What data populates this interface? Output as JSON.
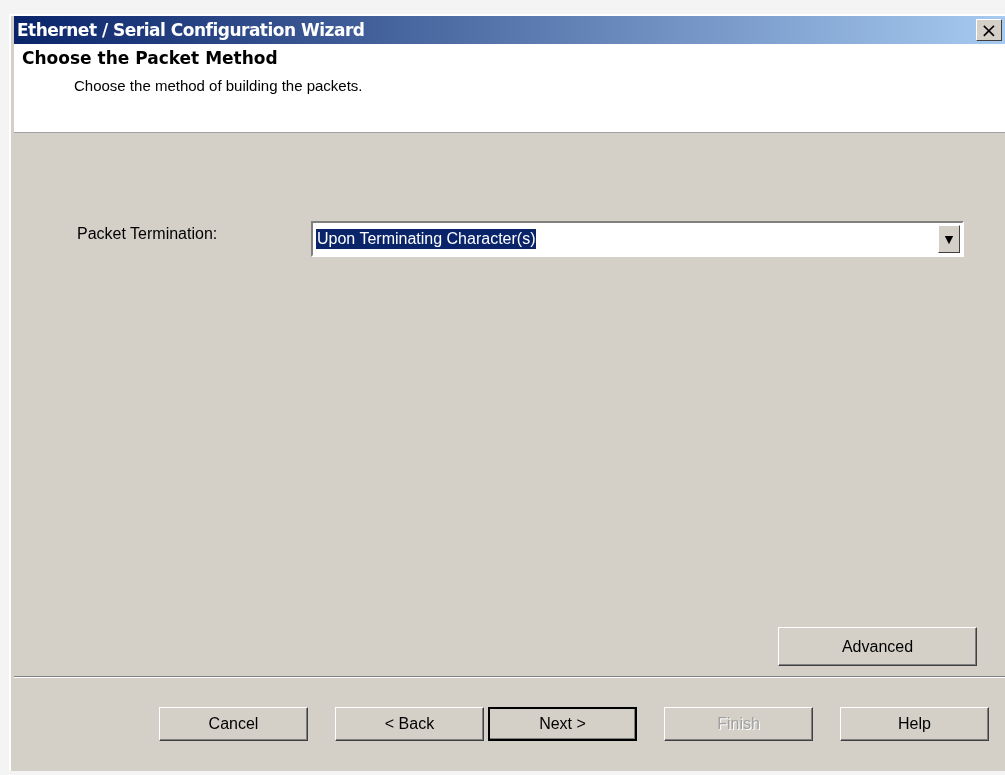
{
  "window": {
    "title": "Ethernet / Serial Configuration Wizard",
    "close": "×"
  },
  "header": {
    "title": "Choose the Packet Method",
    "subtitle": "Choose the method of building the packets."
  },
  "packet_termination": {
    "label": "Packet Termination:",
    "value": "Upon Terminating Character(s)",
    "arrow": "▼"
  },
  "advanced_button": {
    "label": "Advanced",
    "disabled": false
  },
  "buttons": [
    {
      "label": "Cancel",
      "disabled": false,
      "default": false
    },
    {
      "label": "< Back",
      "disabled": false,
      "default": false
    },
    {
      "label": "Next >",
      "disabled": false,
      "default": true
    },
    {
      "label": "Finish",
      "disabled": true,
      "default": false
    },
    {
      "label": "Help",
      "disabled": false,
      "default": false
    }
  ]
}
